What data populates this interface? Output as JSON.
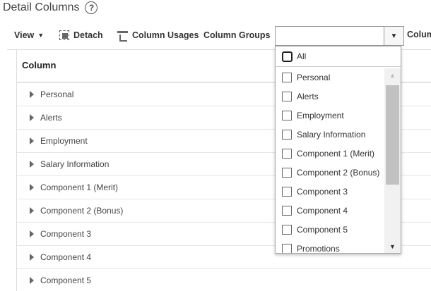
{
  "header": {
    "title": "Detail Columns",
    "help_glyph": "?"
  },
  "toolbar": {
    "view_label": "View",
    "view_caret": "▼",
    "detach_label": "Detach",
    "usages_label": "Column Usages",
    "groups_label": "Column Groups",
    "groups_value": "",
    "combo_caret": "▼",
    "overflow_label": "Colum"
  },
  "table": {
    "column_header": "Column",
    "rows": [
      "Personal",
      "Alerts",
      "Employment",
      "Salary Information",
      "Component 1 (Merit)",
      "Component 2 (Bonus)",
      "Component 3",
      "Component 4",
      "Component 5"
    ]
  },
  "dropdown": {
    "all_label": "All",
    "items": [
      "Personal",
      "Alerts",
      "Employment",
      "Salary Information",
      "Component 1 (Merit)",
      "Component 2 (Bonus)",
      "Component 3",
      "Component 4",
      "Component 5",
      "Promotions"
    ],
    "scroll_up": "▲",
    "scroll_down": "▼"
  }
}
